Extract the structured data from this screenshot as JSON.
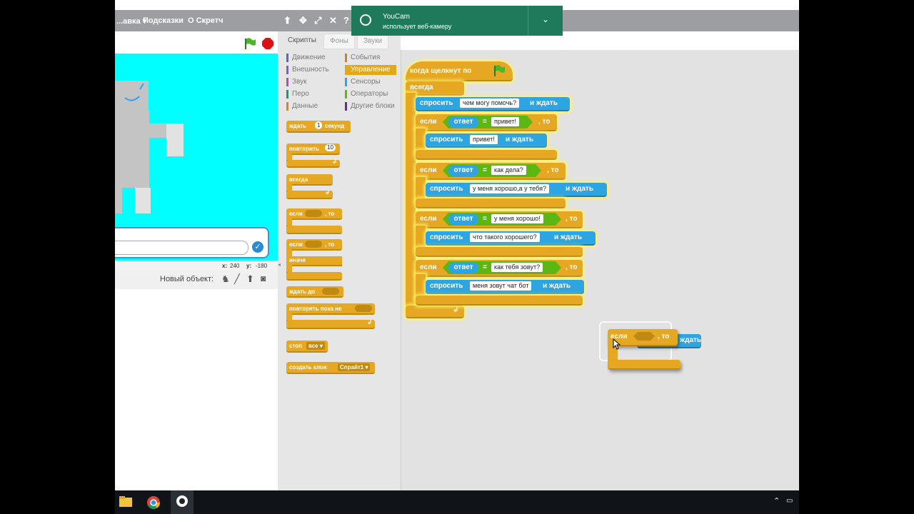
{
  "menubar": {
    "items": [
      "...авка ▾",
      "Подсказки",
      "О Скретч"
    ]
  },
  "notification": {
    "app": "YouCam",
    "message": "использует веб-камеру"
  },
  "stage": {
    "coords": {
      "x_label": "x:",
      "x_value": "240",
      "y_label": "y:",
      "y_value": "-180"
    }
  },
  "sprite_panel": {
    "new_object_label": "Новый объект:"
  },
  "tabs": [
    "Скрипты",
    "Фоны",
    "Звуки"
  ],
  "categories": {
    "left": [
      {
        "label": "Движение",
        "color": "#4a6cd4"
      },
      {
        "label": "Внешность",
        "color": "#8a55d7"
      },
      {
        "label": "Звук",
        "color": "#bb42c3"
      },
      {
        "label": "Перо",
        "color": "#0e9a6c"
      },
      {
        "label": "Данные",
        "color": "#ee7d16"
      }
    ],
    "right": [
      {
        "label": "События",
        "color": "#c88330"
      },
      {
        "label": "Управление",
        "color": "#e1a91a"
      },
      {
        "label": "Сенсоры",
        "color": "#2ca5e2"
      },
      {
        "label": "Операторы",
        "color": "#5cb712"
      },
      {
        "label": "Другие блоки",
        "color": "#632d99"
      }
    ]
  },
  "palette_blocks": {
    "wait": "ждать",
    "wait_value": "1",
    "wait_unit": "секунд",
    "repeat": "повторить",
    "repeat_value": "10",
    "forever": "всегда",
    "if1": "если",
    "then1": ", то",
    "if2": "если",
    "then2": ", то",
    "else": "иначе",
    "wait_until": "ждать до",
    "repeat_until": "повторять пока не",
    "stop": "стоп",
    "stop_value": "все",
    "create_clone": "создать клон",
    "clone_value": "Спрайт1"
  },
  "script": {
    "hat": "когда щелкнут по",
    "forever": "всегда",
    "ask0": {
      "label": "спросить",
      "value": "чем могу помочь?",
      "suffix": "и ждать"
    },
    "conditions": [
      {
        "if": "если",
        "answer": "ответ",
        "eq": "=",
        "value": "привет!",
        "then": ", то",
        "ask": {
          "label": "спросить",
          "value": "привет!",
          "suffix": "и ждать"
        }
      },
      {
        "if": "если",
        "answer": "ответ",
        "eq": "=",
        "value": "как дела?",
        "then": ", то",
        "ask": {
          "label": "спросить",
          "value": "у меня хорошо,а у тебя?",
          "suffix": "и ждать"
        }
      },
      {
        "if": "если",
        "answer": "ответ",
        "eq": "=",
        "value": "у меня хорошо!",
        "then": ", то",
        "ask": {
          "label": "спросить",
          "value": "что такого хорошего?",
          "suffix": "и ждать"
        }
      },
      {
        "if": "если",
        "answer": "ответ",
        "eq": "=",
        "value": "как тебя зовут?",
        "then": ", то",
        "ask": {
          "label": "спросить",
          "value": "меня зовут чат бот",
          "suffix": "и ждать"
        }
      }
    ],
    "dragging": {
      "if": "если",
      "then": ", то",
      "behind_suffix": "ждать"
    }
  }
}
